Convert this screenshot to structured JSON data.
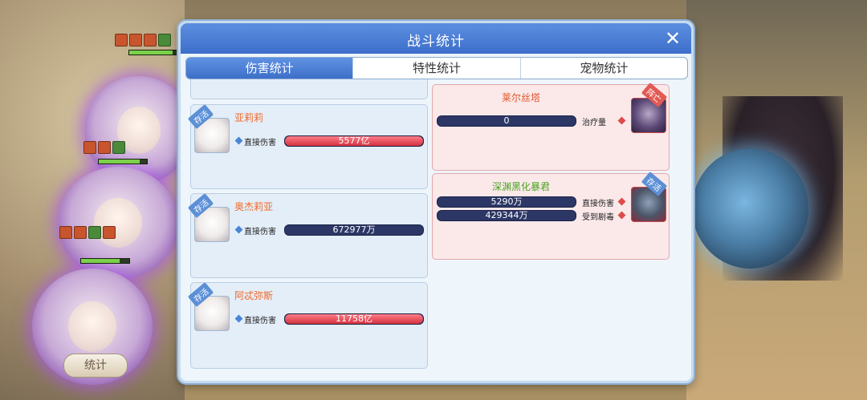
{
  "dialog": {
    "title": "战斗统计",
    "close_glyph": "✕",
    "tabs": [
      {
        "label": "伤害统计",
        "active": true
      },
      {
        "label": "特性统计",
        "active": false
      },
      {
        "label": "宠物统计",
        "active": false
      }
    ]
  },
  "left_team": [
    {
      "name": "亚莉莉",
      "status": "存活",
      "stat_label": "直接伤害",
      "value": "5577亿",
      "fill_ratio": 1.0,
      "bar_style": "red"
    },
    {
      "name": "奥杰莉亚",
      "status": "存活",
      "stat_label": "直接伤害",
      "value": "672977万",
      "fill_ratio": 0.0,
      "bar_style": "navy"
    },
    {
      "name": "阿忒弥斯",
      "status": "存活",
      "stat_label": "直接伤害",
      "value": "11758亿",
      "fill_ratio": 1.0,
      "bar_style": "red"
    }
  ],
  "right_team": [
    {
      "name": "莱尔丝塔",
      "status": "阵亡",
      "stats": [
        {
          "label": "治疗量",
          "value": "0"
        }
      ]
    },
    {
      "name": "深渊黑化暴君",
      "status": "存活",
      "stats": [
        {
          "label": "直接伤害",
          "value": "5290万"
        },
        {
          "label": "受到剧毒",
          "value": "429344万"
        }
      ]
    }
  ],
  "background": {
    "stat_button_label": "统计"
  },
  "colors": {
    "accent_blue": "#3e6fc9",
    "damage_red": "#d2323f",
    "bar_navy": "#2c3766",
    "name_orange": "#f06a2a",
    "enemy_green": "#4aa321"
  }
}
